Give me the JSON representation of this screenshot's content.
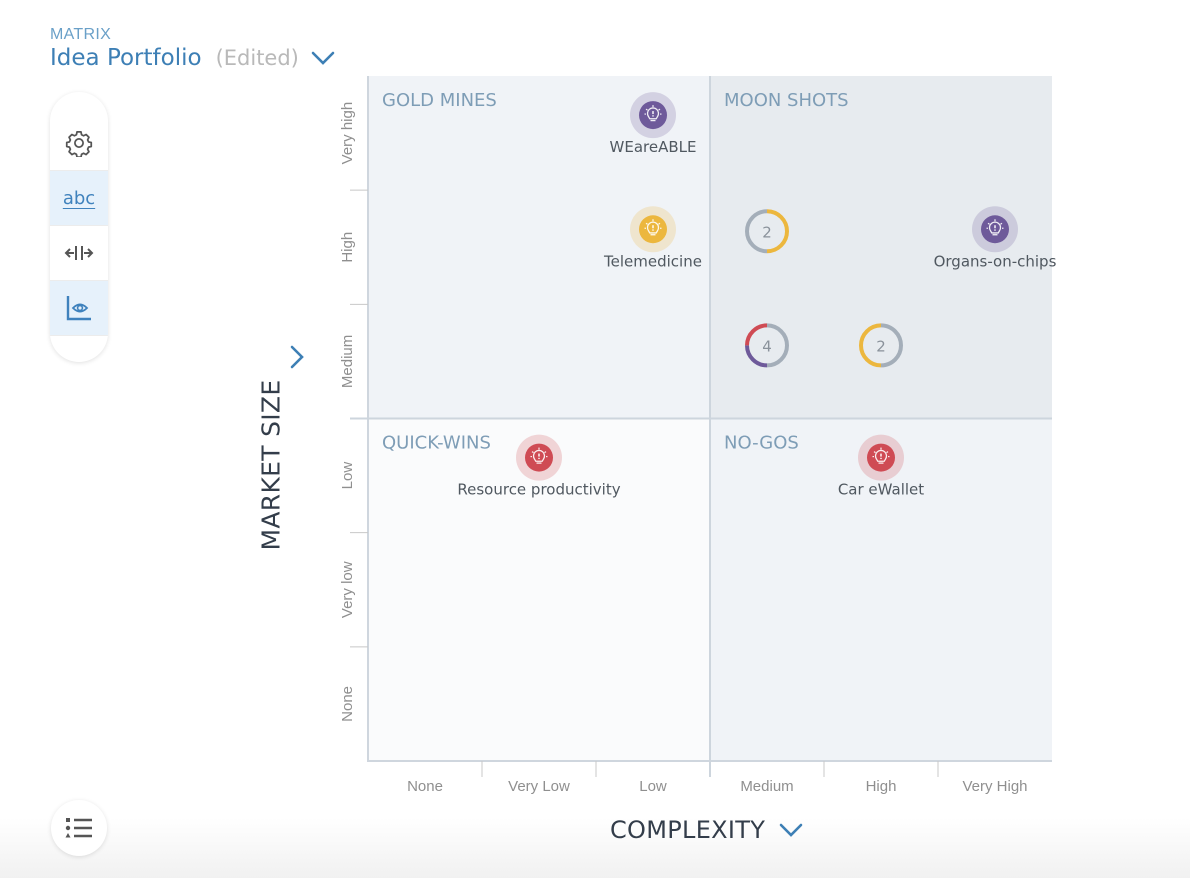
{
  "header": {
    "section_label": "MATRIX",
    "title": "Idea Portfolio",
    "status": "(Edited)"
  },
  "toolbar": {
    "items": [
      {
        "name": "settings",
        "icon": "gear-icon",
        "active": false
      },
      {
        "name": "labels",
        "icon": "abc-text-icon",
        "label": "abc",
        "active": true
      },
      {
        "name": "spacing",
        "icon": "expand-horizontal-icon",
        "active": false
      },
      {
        "name": "visibility",
        "icon": "chart-eye-icon",
        "active": true
      }
    ]
  },
  "legend_button": {
    "icon": "legend-list-icon"
  },
  "colors": {
    "purple": "#6e5a9a",
    "yellow": "#ecb73e",
    "red": "#cf4b54",
    "gray": "#a4aeb9",
    "accent": "#3d7fb5"
  },
  "chart_data": {
    "type": "scatter",
    "title": "Idea Portfolio",
    "xlabel": "COMPLEXITY",
    "ylabel": "MARKET SIZE",
    "x_categories": [
      "None",
      "Very Low",
      "Low",
      "Medium",
      "High",
      "Very High"
    ],
    "y_categories": [
      "None",
      "Very low",
      "Low",
      "Medium",
      "High",
      "Very high"
    ],
    "grid": true,
    "quadrants": [
      {
        "label": "GOLD MINES",
        "position": "top-left",
        "bg": "#f0f3f7"
      },
      {
        "label": "MOON SHOTS",
        "position": "top-right",
        "bg": "#e7ebef"
      },
      {
        "label": "QUICK-WINS",
        "position": "bottom-left",
        "bg": "#fafbfc"
      },
      {
        "label": "NO-GOS",
        "position": "bottom-right",
        "bg": "#f0f3f7"
      }
    ],
    "points": [
      {
        "label": "WEareABLE",
        "x": "Low",
        "y": "Very high",
        "color": "purple",
        "icon": "lightbulb-icon"
      },
      {
        "label": "Telemedicine",
        "x": "Low",
        "y": "High",
        "color": "yellow",
        "icon": "lightbulb-icon"
      },
      {
        "label": "Organs-on-chips",
        "x": "Very High",
        "y": "High",
        "color": "purple",
        "icon": "lightbulb-icon"
      },
      {
        "label": "Resource productivity",
        "x": "Very Low",
        "y": "Low",
        "color": "red",
        "icon": "lightbulb-icon"
      },
      {
        "label": "Car eWallet",
        "x": "High",
        "y": "Low",
        "color": "red",
        "icon": "lightbulb-icon"
      }
    ],
    "clusters": [
      {
        "count": 2,
        "x": "Medium",
        "y": "High",
        "segments": [
          {
            "color": "yellow",
            "share": 0.5
          },
          {
            "color": "gray",
            "share": 0.5
          }
        ]
      },
      {
        "count": 4,
        "x": "Medium",
        "y": "Medium",
        "segments": [
          {
            "color": "gray",
            "share": 0.5
          },
          {
            "color": "purple",
            "share": 0.25
          },
          {
            "color": "red",
            "share": 0.25
          }
        ]
      },
      {
        "count": 2,
        "x": "High",
        "y": "Medium",
        "segments": [
          {
            "color": "gray",
            "share": 0.5
          },
          {
            "color": "yellow",
            "share": 0.5
          }
        ]
      }
    ]
  }
}
